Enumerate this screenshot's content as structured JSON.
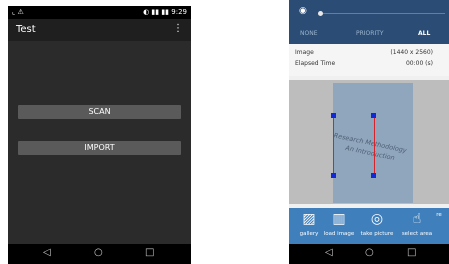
{
  "left_screen": {
    "status_bar": {
      "left_icons": "⌞ ⚠",
      "right_icons": "◐ ▮▮ ▮▮",
      "time": "9:29"
    },
    "app_bar": {
      "title": "Test",
      "menu_icon": "⋮"
    },
    "buttons": {
      "scan": "SCAN",
      "import": "IMPORT"
    },
    "nav": {
      "back": "◁",
      "home": "○",
      "recent": "□"
    }
  },
  "right_screen": {
    "notification": {
      "vibrate_icon": "◉",
      "tabs": [
        "NONE",
        "PRIORITY",
        "ALL"
      ]
    },
    "info": [
      {
        "label": "Image",
        "value": "(1440 x 2560)"
      },
      {
        "label": "Elapsed Time",
        "value": "00:00 (s)"
      }
    ],
    "document": {
      "line1": "Research Methodology",
      "line2": "An Introduction"
    },
    "toolbar": [
      {
        "glyph": "▨",
        "label": "gallery"
      },
      {
        "glyph": "▥",
        "label": "load image"
      },
      {
        "glyph": "◎",
        "label": "take picture"
      },
      {
        "glyph": "☝",
        "label": "select area"
      },
      {
        "glyph": "",
        "label": "re"
      }
    ],
    "nav": {
      "back": "◁",
      "home": "○",
      "recent": "□"
    }
  }
}
